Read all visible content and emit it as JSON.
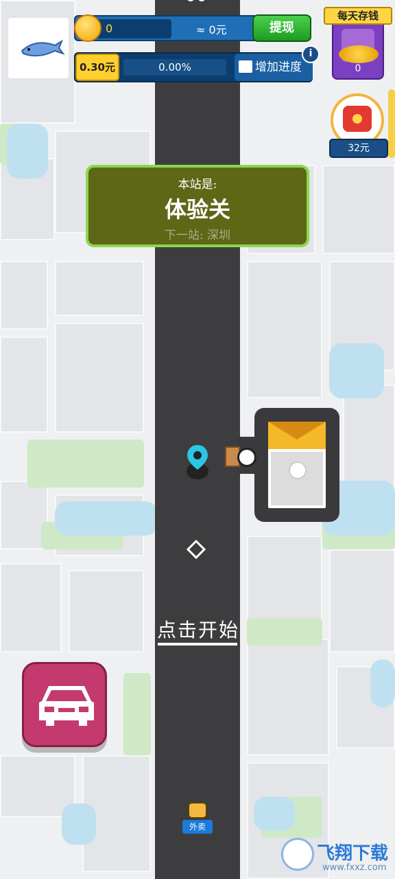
{
  "hud": {
    "coins": "0",
    "coins_cash": "≈ 0元",
    "withdraw_label": "提现",
    "reward_amount": "0.30元",
    "progress_percent": "0.00%",
    "add_progress_label": "增加进度",
    "info_symbol": "i"
  },
  "daily_savings": {
    "title": "每天存钱",
    "value": "0"
  },
  "red_packet": {
    "value": "32元"
  },
  "station": {
    "label": "本站是:",
    "name": "体验关",
    "next": "下一站: 深圳"
  },
  "start_prompt": "点击开始",
  "delivery_tag": "外卖",
  "watermark": {
    "brand": "飞翔下载",
    "site": "www.fxxz.com"
  },
  "colors": {
    "road": "#3d3d3f",
    "station_bg": "#5e6716",
    "station_border": "#8bd64f",
    "car_button": "#c43a6e",
    "pin": "#2bc6e6"
  },
  "icons": {
    "avatar": "shark-icon",
    "coin": "coin-icon",
    "video": "clapperboard-icon",
    "safe": "safe-icon",
    "red_packet": "red-envelope-icon",
    "car": "car-icon",
    "pin": "location-pin-icon"
  }
}
